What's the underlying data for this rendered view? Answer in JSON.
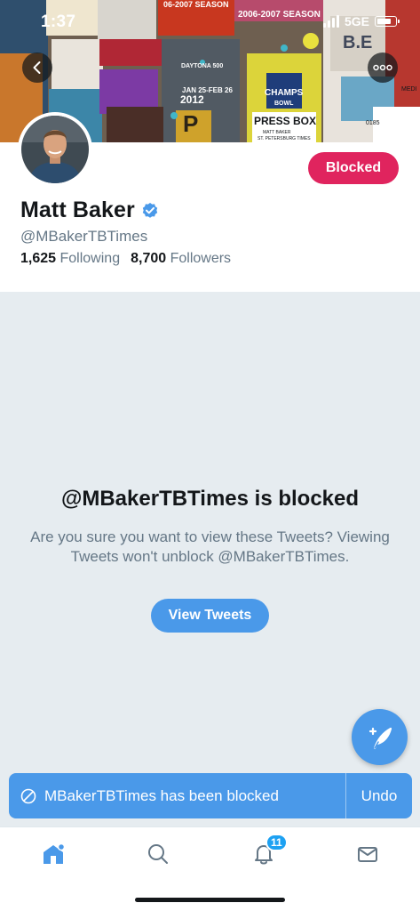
{
  "status_bar": {
    "time": "1:37",
    "network": "5GE"
  },
  "banner": {
    "signs": [
      "06-2007 SEASON",
      "2006-2007 SEASON",
      "DAYTONA 500",
      "JAN 25-FEB 26",
      "2012",
      "CHAMPS",
      "BOWL",
      "PRESS BOX",
      "MATT BAKER",
      "ST. PETERSBURG TIMES",
      "B.E",
      "0185",
      "MEDI",
      "P"
    ]
  },
  "profile": {
    "name": "Matt Baker",
    "handle": "@MBakerTBTimes",
    "following_count": "1,625",
    "following_label": "Following",
    "followers_count": "8,700",
    "followers_label": "Followers",
    "blocked_button": "Blocked"
  },
  "blocked_notice": {
    "title": "@MBakerTBTimes is blocked",
    "message": "Are you sure you want to view these Tweets? Viewing Tweets won't unblock @MBakerTBTimes.",
    "view_button": "View Tweets"
  },
  "toast": {
    "text": "MBakerTBTimes has been blocked",
    "action": "Undo"
  },
  "tab_bar": {
    "notification_count": "11"
  },
  "colors": {
    "accent": "#4a99e9",
    "blocked": "#e0245e",
    "panel_bg": "#e6ecf0",
    "muted_text": "#657786"
  }
}
